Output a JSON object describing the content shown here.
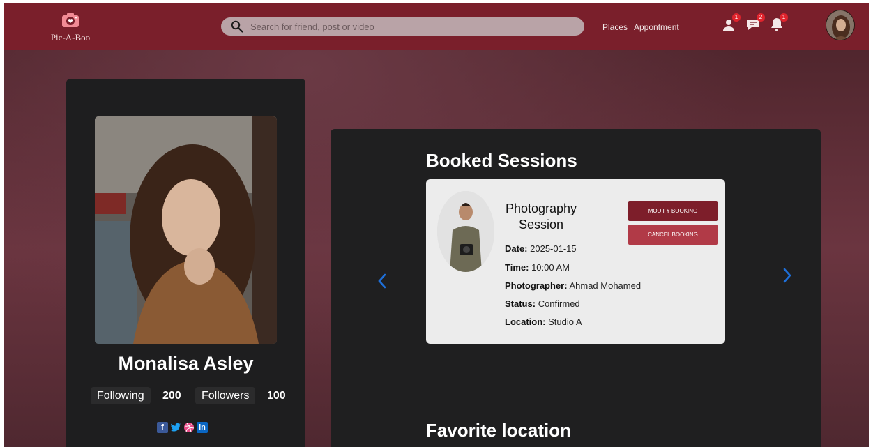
{
  "header": {
    "logo_text": "Pic-A-Boo",
    "search_placeholder": "Search for friend, post or video",
    "nav": [
      "Places",
      "Appontment"
    ],
    "badges": {
      "friends": "1",
      "messages": "2",
      "notifications": "1"
    },
    "brand_color": "#7a1f2b"
  },
  "profile": {
    "name": "Monalisa Asley",
    "following_label": "Following",
    "following_count": "200",
    "followers_label": "Followers",
    "followers_count": "100",
    "socials": [
      "facebook-icon",
      "twitter-icon",
      "dribbble-icon",
      "linkedin-icon"
    ]
  },
  "sessions": {
    "title": "Booked Sessions",
    "card": {
      "title": "Photography Session",
      "date_label": "Date:",
      "date": "2025-01-15",
      "time_label": "Time:",
      "time": "10:00 AM",
      "photographer_label": "Photographer:",
      "photographer": "Ahmad Mohamed",
      "status_label": "Status:",
      "status": "Confirmed",
      "location_label": "Location:",
      "location": "Studio A",
      "modify_label": "Modify Booking",
      "cancel_label": "Cancel Booking"
    },
    "arrow_color": "#1e6fd9"
  },
  "favorite": {
    "title": "Favorite location"
  }
}
